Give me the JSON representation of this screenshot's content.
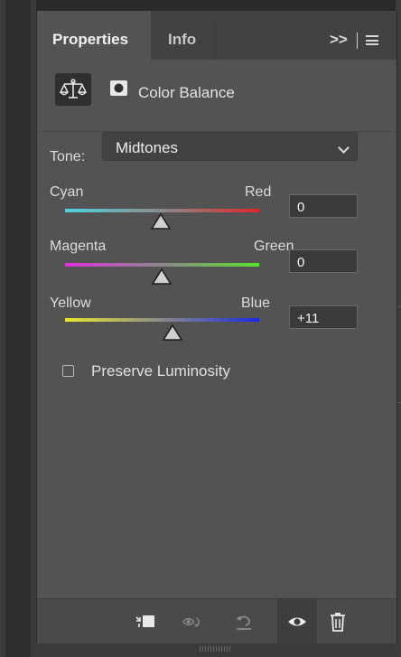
{
  "tabs": [
    {
      "label": "Properties",
      "active": true
    },
    {
      "label": "Info",
      "active": false
    }
  ],
  "panel_menu": {
    "expand_label": ">>"
  },
  "header": {
    "title": "Color Balance",
    "icon": "scale-icon",
    "mask_icon": "mask-icon"
  },
  "tone": {
    "label": "Tone:",
    "value": "Midtones"
  },
  "sliders": [
    {
      "left_label": "Cyan",
      "right_label": "Red",
      "value": "0",
      "left_color": "#4fd4e0",
      "right_color": "#e0262a"
    },
    {
      "left_label": "Magenta",
      "right_label": "Green",
      "value": "0",
      "left_color": "#e030e0",
      "right_color": "#5ae02a"
    },
    {
      "left_label": "Yellow",
      "right_label": "Blue",
      "value": "+11",
      "left_color": "#e8e82a",
      "right_color": "#1a2ae8"
    }
  ],
  "preserve_luminosity": {
    "label": "Preserve Luminosity",
    "checked": false
  },
  "footer_icons": [
    "clip-to-layer-icon",
    "view-previous-state-icon",
    "reset-icon",
    "visibility-icon",
    "delete-icon"
  ]
}
